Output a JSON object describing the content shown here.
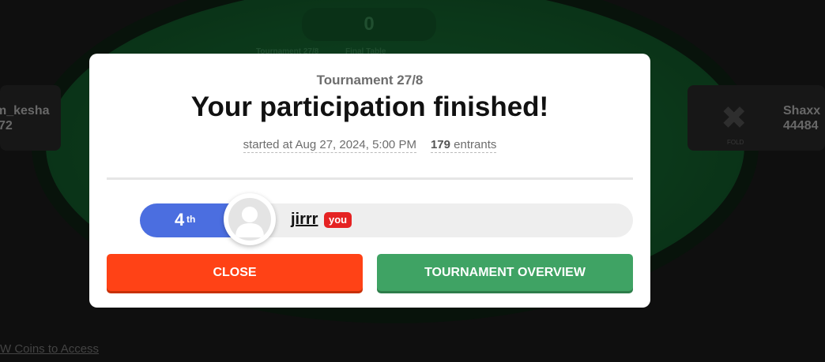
{
  "background": {
    "pot_value": "0",
    "table_label_left": "Tournament 27/8",
    "table_label_right": "Final Table",
    "seat_left": {
      "name": "m_kesha",
      "stack": "72"
    },
    "seat_right": {
      "name": "Shaxx",
      "stack": "44484",
      "status": "FOLD"
    },
    "coins_link": "W Coins to Access",
    "felt_color": "#1c7a3d"
  },
  "modal": {
    "subtitle": "Tournament 27/8",
    "title": "Your participation finished!",
    "started_label": "started at Aug 27, 2024, 5:00 PM",
    "entrants_count": "179",
    "entrants_label": "entrants",
    "result": {
      "place_number": "4",
      "place_suffix": "th",
      "player_name": "jirrr",
      "you_badge": "you"
    },
    "buttons": {
      "close": "CLOSE",
      "overview": "TOURNAMENT OVERVIEW"
    }
  },
  "colors": {
    "close_button": "#ff4216",
    "overview_button": "#3fa364",
    "place_pill": "#4b6ee0",
    "you_badge": "#e52222"
  }
}
